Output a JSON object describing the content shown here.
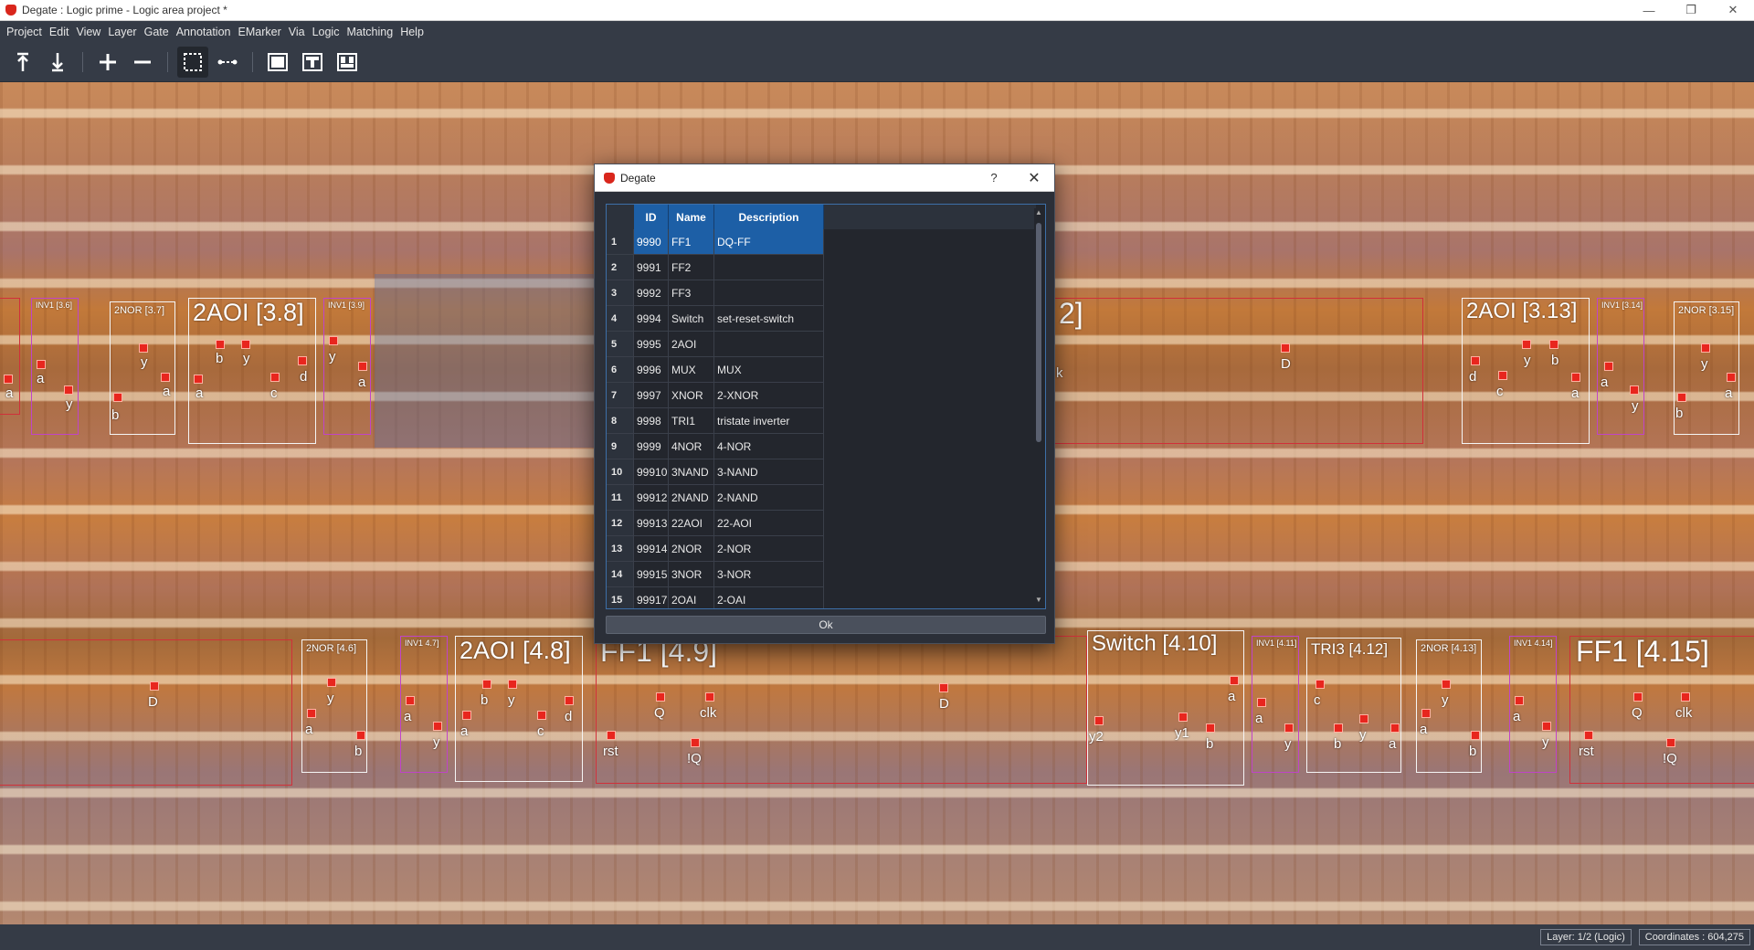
{
  "window": {
    "title": "Degate : Logic prime - Logic area project *",
    "minimize": "—",
    "restore": "❐",
    "close": "✕"
  },
  "menu": [
    "Project",
    "Edit",
    "View",
    "Layer",
    "Gate",
    "Annotation",
    "EMarker",
    "Via",
    "Logic",
    "Matching",
    "Help"
  ],
  "toolbar_icons": [
    "layer-up-icon",
    "layer-down-icon",
    "zoom-in-icon",
    "zoom-out-icon",
    "area-select-icon",
    "wire-tool-icon",
    "background-layer-icon",
    "top-layer-icon",
    "bottom-layer-icon"
  ],
  "canvas": {
    "cells": [
      {
        "label": "2NOR [3.7]"
      },
      {
        "label": "2AOI [3.8]"
      },
      {
        "label": "INV1 [3.9]"
      },
      {
        "label": "INV1 [3.6]"
      },
      {
        "label": "2]"
      },
      {
        "label": "2AOI [3.13]"
      },
      {
        "label": "INV1 [3.14]"
      },
      {
        "label": "2NOR [3.15]"
      },
      {
        "label": "2NOR [4.6]"
      },
      {
        "label": "INV1 4.7]"
      },
      {
        "label": "2AOI [4.8]"
      },
      {
        "label": "FF1 [4.9]"
      },
      {
        "label": "Switch [4.10]"
      },
      {
        "label": "INV1 [4.11]"
      },
      {
        "label": "TRI3 [4.12]"
      },
      {
        "label": "2NOR [4.13]"
      },
      {
        "label": "INV1 4.14]"
      },
      {
        "label": "FF1 [4.15]"
      }
    ],
    "pins": [
      "a",
      "y",
      "b",
      "y",
      "a",
      "a",
      "b",
      "y",
      "c",
      "d",
      "y",
      "a",
      "k",
      "D",
      "d",
      "c",
      "y",
      "b",
      "a",
      "a",
      "y",
      "y",
      "b",
      "a",
      "D",
      "y",
      "a",
      "b",
      "a",
      "y",
      "b",
      "y",
      "a",
      "c",
      "d",
      "Q",
      "clk",
      "rst",
      "!Q",
      "D",
      "y2",
      "y1",
      "b",
      "a",
      "a",
      "y",
      "c",
      "b",
      "y",
      "a",
      "y",
      "a",
      "b",
      "a",
      "y",
      "Q",
      "clk",
      "rst",
      "!Q"
    ]
  },
  "dialog": {
    "title": "Degate",
    "help": "?",
    "close": "✕",
    "columns": [
      "ID",
      "Name",
      "Description"
    ],
    "rows": [
      {
        "num": "1",
        "id": "9990",
        "name": "FF1",
        "description": "DQ-FF"
      },
      {
        "num": "2",
        "id": "9991",
        "name": "FF2",
        "description": ""
      },
      {
        "num": "3",
        "id": "9992",
        "name": "FF3",
        "description": ""
      },
      {
        "num": "4",
        "id": "9994",
        "name": "Switch",
        "description": "set-reset-switch"
      },
      {
        "num": "5",
        "id": "9995",
        "name": "2AOI",
        "description": ""
      },
      {
        "num": "6",
        "id": "9996",
        "name": "MUX",
        "description": "MUX"
      },
      {
        "num": "7",
        "id": "9997",
        "name": "XNOR",
        "description": "2-XNOR"
      },
      {
        "num": "8",
        "id": "9998",
        "name": "TRI1",
        "description": "tristate inverter"
      },
      {
        "num": "9",
        "id": "9999",
        "name": "4NOR",
        "description": "4-NOR"
      },
      {
        "num": "10",
        "id": "99910",
        "name": "3NAND",
        "description": "3-NAND"
      },
      {
        "num": "11",
        "id": "99912",
        "name": "2NAND",
        "description": "2-NAND"
      },
      {
        "num": "12",
        "id": "99913",
        "name": "22AOI",
        "description": "22-AOI"
      },
      {
        "num": "13",
        "id": "99914",
        "name": "2NOR",
        "description": "2-NOR"
      },
      {
        "num": "14",
        "id": "99915",
        "name": "3NOR",
        "description": "3-NOR"
      },
      {
        "num": "15",
        "id": "99917",
        "name": "2OAI",
        "description": "2-OAI"
      }
    ],
    "selected_row": 1,
    "ok_label": "Ok"
  },
  "status": {
    "layer": "Layer: 1/2 (Logic)",
    "coordinates": "Coordinates : 604,275"
  },
  "colors": {
    "accent": "#1d5fa6",
    "pin": "#e8261e",
    "chrome": "#353b46"
  }
}
